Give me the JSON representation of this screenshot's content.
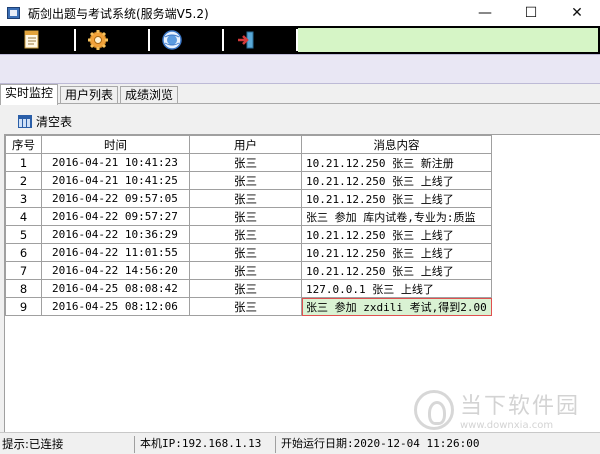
{
  "window": {
    "title": "砺剑出题与考试系统(服务端V5.2)",
    "minimize_glyph": "—",
    "maximize_glyph": "☐",
    "close_glyph": "✕"
  },
  "toolbar": {
    "buttons": [
      {
        "icon": "document-icon"
      },
      {
        "icon": "gear-icon"
      },
      {
        "icon": "network-globe-icon"
      },
      {
        "icon": "exit-door-icon"
      }
    ],
    "accent_color": "#d6f5c6"
  },
  "tabs": [
    {
      "label": "实时监控",
      "active": true
    },
    {
      "label": "用户列表",
      "active": false
    },
    {
      "label": "成绩浏览",
      "active": false
    }
  ],
  "actions": {
    "clear_label": "清空表"
  },
  "table": {
    "columns": [
      "序号",
      "时间",
      "用户",
      "消息内容"
    ],
    "rows": [
      {
        "no": "1",
        "time": "2016-04-21 10:41:23",
        "user": "张三",
        "msg": "10.21.12.250   张三   新注册"
      },
      {
        "no": "2",
        "time": "2016-04-21 10:41:25",
        "user": "张三",
        "msg": "10.21.12.250   张三   上线了"
      },
      {
        "no": "3",
        "time": "2016-04-22 09:57:05",
        "user": "张三",
        "msg": "10.21.12.250   张三   上线了"
      },
      {
        "no": "4",
        "time": "2016-04-22 09:57:27",
        "user": "张三",
        "msg": "张三 参加 库内试卷,专业为:质监"
      },
      {
        "no": "5",
        "time": "2016-04-22 10:36:29",
        "user": "张三",
        "msg": "10.21.12.250   张三   上线了"
      },
      {
        "no": "6",
        "time": "2016-04-22 11:01:55",
        "user": "张三",
        "msg": "10.21.12.250   张三   上线了"
      },
      {
        "no": "7",
        "time": "2016-04-22 14:56:20",
        "user": "张三",
        "msg": "10.21.12.250   张三   上线了"
      },
      {
        "no": "8",
        "time": "2016-04-25 08:08:42",
        "user": "张三",
        "msg": "127.0.0.1   张三   上线了"
      },
      {
        "no": "9",
        "time": "2016-04-25 08:12:06",
        "user": "张三",
        "msg": "张三 参加 zxdili 考试,得到2.00"
      }
    ],
    "selected_row": 9
  },
  "watermark": {
    "text": "当下软件园",
    "url": "www.downxia.com"
  },
  "status": {
    "hint": "提示:已连接",
    "ip": "本机IP:192.168.1.13",
    "start": "开始运行日期:2020-12-04 11:26:00"
  }
}
